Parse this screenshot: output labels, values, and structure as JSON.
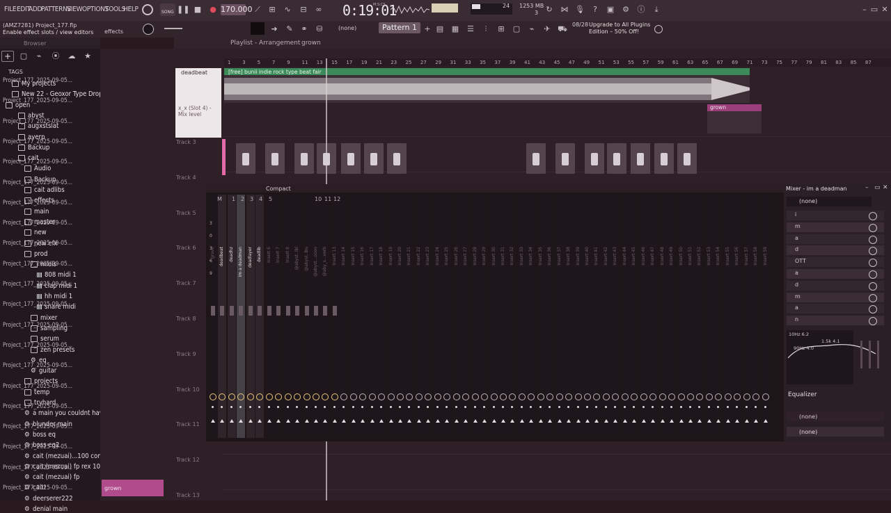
{
  "menubar": {
    "items": [
      "FILE",
      "EDIT",
      "ADD",
      "PATTERNS",
      "VIEW",
      "OPTIONS",
      "TOOLS",
      "HELP"
    ],
    "song_label": "SONG",
    "bpm": "170.000",
    "time": "0:19:01",
    "time_unit": "M:S:CS",
    "cpu_value": "24",
    "mem": "1253 MB",
    "mem_sub": "3"
  },
  "bar2": {
    "project_file": "(AMZ7281) Project_177.flp",
    "hint": "Enable effect slots / view editors",
    "effects_label": "effects",
    "channel_none": "(none)",
    "pattern": "Pattern 1",
    "news_count": "08/28",
    "news_text": "Upgrade to All Plugins Edition – 50% Off!"
  },
  "browser": {
    "title": "Browser",
    "tags_label": "TAGS",
    "items": [
      {
        "label": "My projects",
        "indent": 1,
        "kind": "folder"
      },
      {
        "label": "New 22 - Geoxor Type Drop",
        "indent": 1,
        "kind": "folder"
      },
      {
        "label": "open",
        "indent": 0,
        "kind": "folder"
      },
      {
        "label": "abyst",
        "indent": 2,
        "kind": "folder"
      },
      {
        "label": "augxstslat",
        "indent": 2,
        "kind": "folder"
      },
      {
        "label": "ayerp",
        "indent": 2,
        "kind": "folder"
      },
      {
        "label": "Backup",
        "indent": 2,
        "kind": "folder"
      },
      {
        "label": "cait",
        "indent": 2,
        "kind": "folder"
      },
      {
        "label": "Audio",
        "indent": 3,
        "kind": "folder"
      },
      {
        "label": "Backup",
        "indent": 3,
        "kind": "folder"
      },
      {
        "label": "cait adlibs",
        "indent": 3,
        "kind": "folder"
      },
      {
        "label": "effects",
        "indent": 3,
        "kind": "folder"
      },
      {
        "label": "main",
        "indent": 3,
        "kind": "folder"
      },
      {
        "label": "master",
        "indent": 3,
        "kind": "folder"
      },
      {
        "label": "new",
        "indent": 3,
        "kind": "folder"
      },
      {
        "label": "new efx",
        "indent": 3,
        "kind": "folder"
      },
      {
        "label": "prod",
        "indent": 3,
        "kind": "folder"
      },
      {
        "label": "midis",
        "indent": 4,
        "kind": "folder"
      },
      {
        "label": "808 midi 1",
        "indent": 5,
        "kind": "midi"
      },
      {
        "label": "clap midi 1",
        "indent": 5,
        "kind": "midi"
      },
      {
        "label": "hh midi 1",
        "indent": 5,
        "kind": "midi"
      },
      {
        "label": "snare midi",
        "indent": 5,
        "kind": "midi"
      },
      {
        "label": "mixer",
        "indent": 4,
        "kind": "folder"
      },
      {
        "label": "sampling",
        "indent": 4,
        "kind": "folder"
      },
      {
        "label": "serum",
        "indent": 4,
        "kind": "folder"
      },
      {
        "label": "zen presets",
        "indent": 4,
        "kind": "folder"
      },
      {
        "label": "eq",
        "indent": 4,
        "kind": "gear"
      },
      {
        "label": "guitar",
        "indent": 4,
        "kind": "gear"
      },
      {
        "label": "projects",
        "indent": 3,
        "kind": "folder"
      },
      {
        "label": "temp",
        "indent": 3,
        "kind": "folder"
      },
      {
        "label": "tryhard",
        "indent": 3,
        "kind": "folder"
      },
      {
        "label": "a main you couldnt have...",
        "indent": 3,
        "kind": "gear"
      },
      {
        "label": "blunder main",
        "indent": 3,
        "kind": "gear"
      },
      {
        "label": "boss eq",
        "indent": 3,
        "kind": "gear"
      },
      {
        "label": "boss eq2",
        "indent": 3,
        "kind": "gear"
      },
      {
        "label": "cait (mezuai)...100 controlla",
        "indent": 3,
        "kind": "gear"
      },
      {
        "label": "cait (mezuai) fp rex 100",
        "indent": 3,
        "kind": "gear"
      },
      {
        "label": "cait (mezuai) fp",
        "indent": 3,
        "kind": "gear"
      },
      {
        "label": "cait!",
        "indent": 3,
        "kind": "gear"
      },
      {
        "label": "deerserer222",
        "indent": 3,
        "kind": "gear"
      },
      {
        "label": "denial main",
        "indent": 3,
        "kind": "gear"
      }
    ]
  },
  "projects": {
    "item": "Project_177_2025-09-05...",
    "count": 21,
    "grown_clip": "grown"
  },
  "playlist": {
    "title": "Playlist - Arrangement",
    "arrangement": "grown",
    "ruler": [
      "1",
      "3",
      "5",
      "7",
      "9",
      "11",
      "13",
      "15",
      "17",
      "19",
      "21",
      "23",
      "25",
      "27",
      "29",
      "31",
      "33",
      "35",
      "37",
      "39",
      "41",
      "43",
      "45",
      "47",
      "49",
      "51",
      "53",
      "55",
      "57",
      "59",
      "61",
      "63",
      "65",
      "67",
      "69",
      "71",
      "73",
      "75",
      "77",
      "79",
      "81",
      "83",
      "85",
      "87"
    ],
    "track_labels": [
      "Track 3",
      "Track 4",
      "Track 5",
      "Track 6",
      "Track 7",
      "Track 8",
      "Track 9",
      "Track 10",
      "Track 11",
      "Track 12",
      "Track 13"
    ],
    "audio_clip": "[free] bunii indie rock type beat fair",
    "grown_clip": "grown",
    "channel_name": "deadbeat",
    "slot_label": "x_x (Slot 4) - Mix level"
  },
  "mixer": {
    "layout": "Compact",
    "title": "Mixer - im a deadman",
    "inserts": [
      "grave",
      "deadbeat",
      "deadhz",
      "im a deadman",
      "deadlayer",
      "deadlib",
      "Insert 6",
      "Insert 7",
      "Insert 8",
      "@abyst..lbl",
      "@abyst..lbs",
      "@abyst...oooo",
      "@aby_s...verb",
      "Insert 13",
      "Insert 14",
      "Insert 15",
      "Insert 16",
      "Insert 17",
      "Insert 18",
      "Insert 19",
      "Insert 20",
      "Insert 21",
      "Insert 22",
      "Insert 23",
      "Insert 24",
      "Insert 25",
      "Insert 26",
      "Insert 27",
      "Insert 28",
      "Insert 29",
      "Insert 30",
      "Insert 31",
      "Insert 32",
      "Insert 33",
      "Insert 34",
      "Insert 35",
      "Insert 36",
      "Insert 37",
      "Insert 38",
      "Insert 39",
      "Insert 40",
      "Insert 41",
      "Insert 42",
      "Insert 43",
      "Insert 44",
      "Insert 45",
      "Insert 46",
      "Insert 47",
      "Insert 48",
      "Insert 49",
      "Insert 50",
      "Insert 51",
      "Insert 52",
      "Insert 53",
      "Insert 54",
      "Insert 55",
      "Insert 56",
      "Insert 57",
      "Insert 58",
      "Insert 59"
    ],
    "top_numbers": [
      "M",
      "1",
      "2",
      "3",
      "4",
      "5",
      "10",
      "11",
      "12"
    ],
    "meter_scale": [
      "3",
      "0",
      "3",
      "6",
      "9"
    ],
    "input_none": "(none)",
    "slots": [
      "i",
      "m",
      "a",
      "d",
      "OTT",
      "a",
      "d",
      "m",
      "a",
      "n"
    ],
    "eq_hz": "10Hz 6.2",
    "eq_mid": "1.5k 4.1",
    "eq_lo": "90Hz 4.0",
    "equalizer_label": "Equalizer",
    "out_none": "(none)",
    "out2_none": "(none)"
  }
}
